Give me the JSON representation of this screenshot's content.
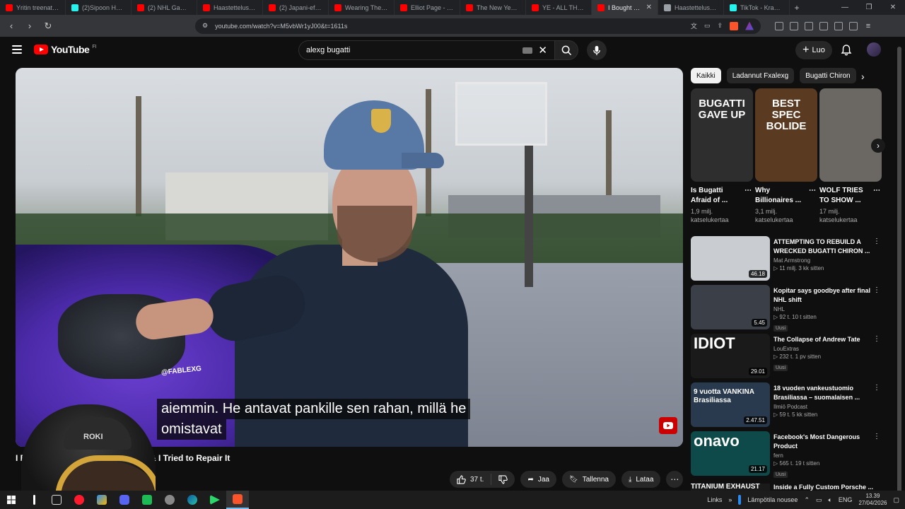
{
  "browser": {
    "tabs": [
      {
        "title": "Yritin treenata p",
        "color": "#ff0000"
      },
      {
        "title": "(2)Sipoon Hertu",
        "color": "#25f4ee"
      },
      {
        "title": "(2) NHL Game A",
        "color": "#ff0000"
      },
      {
        "title": "Haastettelussa Vi",
        "color": "#ff0000"
      },
      {
        "title": "(2) Japani-efekti",
        "color": "#ff0000"
      },
      {
        "title": "Wearing The Ne",
        "color": "#ff0000"
      },
      {
        "title": "Elliot Page - You",
        "color": "#ff0000"
      },
      {
        "title": "The New Yeezy S",
        "color": "#ff0000"
      },
      {
        "title": "YE - ALL THE LO",
        "color": "#ff0000"
      },
      {
        "title": "I Bought a B",
        "color": "#ff0000",
        "active": true
      },
      {
        "title": "Haastettelussa O",
        "color": "#9aa0a6"
      },
      {
        "title": "TikTok - Kraune",
        "color": "#25f4ee"
      }
    ],
    "new_tab": "+",
    "url": "youtube.com/watch?v=M5vbWr1yJ00&t=1611s"
  },
  "header": {
    "logo_text": "YouTube",
    "country_code": "FI",
    "search_value": "alexg bugatti",
    "create_label": "Luo"
  },
  "player": {
    "caption_line1": "aiemmin.  He antavat pankille sen rahan, millä he",
    "caption_line2": "omistavat",
    "sticker_text": "@FABLEXG"
  },
  "video": {
    "title": "I Bou",
    "title_tail": "& I Tried to Repair It",
    "likes": "37 t.",
    "share_label": "Jaa",
    "save_label": "Tallenna",
    "download_label": "Lataa"
  },
  "webcam": {
    "hat_label": "ROKI"
  },
  "chips": [
    "Kaikki",
    "Ladannut Fxalexg",
    "Bugatti Chiron"
  ],
  "shorts": [
    {
      "thumb_text": "BUGATTI GAVE UP",
      "title_line1": "Is Bugatti",
      "title_line2": "Afraid of ...",
      "views_line1": "1,9 milj.",
      "views_line2": "katselukertaa",
      "bg": "#2e2e2e",
      "text_color": "#ffffff"
    },
    {
      "thumb_text": "BEST SPEC BOLIDE",
      "title_line1": "Why",
      "title_line2": "Billionaires ...",
      "views_line1": "3,1 milj.",
      "views_line2": "katselukertaa",
      "bg": "#5a3a20",
      "text_color": "#ffffff"
    },
    {
      "thumb_text": "",
      "title_line1": "WOLF TRIES",
      "title_line2": "TO SHOW ...",
      "views_line1": "17 milj.",
      "views_line2": "katselukertaa",
      "bg": "#6b6864",
      "text_color": "#ffffff"
    }
  ],
  "recommendations": [
    {
      "title": "ATTEMPTING TO REBUILD A WRECKED BUGATTI CHIRON ...",
      "channel": "Mat Armstrong",
      "meta": "▷ 11 milj.  3 kk sitten",
      "duration": "46.18",
      "badge": "",
      "bg": "#c9ccd1",
      "thumb_text": ""
    },
    {
      "title": "Kopitar says goodbye after final NHL shift",
      "channel": "NHL",
      "meta": "▷ 92 t.  10 t sitten",
      "duration": "5.45",
      "badge": "Uusi",
      "bg": "#3a3f48",
      "thumb_text": ""
    },
    {
      "title": "The Collapse of Andrew Tate",
      "channel": "LouExtras",
      "meta": "▷ 232 t.  1 pv sitten",
      "duration": "29.01",
      "badge": "Uusi",
      "bg": "#1a1a1a",
      "thumb_text": "IDIOT"
    },
    {
      "title": "18 vuoden vankeustuomio Brasiliassa – suomalaisen ...",
      "channel": "Ilmiö Podcast",
      "meta": "▷ 59 t.  5 kk sitten",
      "duration": "2.47.51",
      "badge": "",
      "bg": "#2a3a4e",
      "thumb_text": "9 vuotta VANKINA Brasiliassa"
    },
    {
      "title": "Facebook's Most Dangerous Product",
      "channel": "fern",
      "meta": "▷ 565 t.  19 t sitten",
      "duration": "21.17",
      "badge": "Uusi",
      "bg": "#0e4a4a",
      "thumb_text": "onavo"
    }
  ],
  "cutoff_rec": {
    "title": "Inside a Fully Custom Porsche ..."
  },
  "taskbar": {
    "links_label": "Links",
    "weather": "Lämpötila nousee",
    "lang": "ENG",
    "time": "13.39",
    "date": "27/04/2026"
  }
}
